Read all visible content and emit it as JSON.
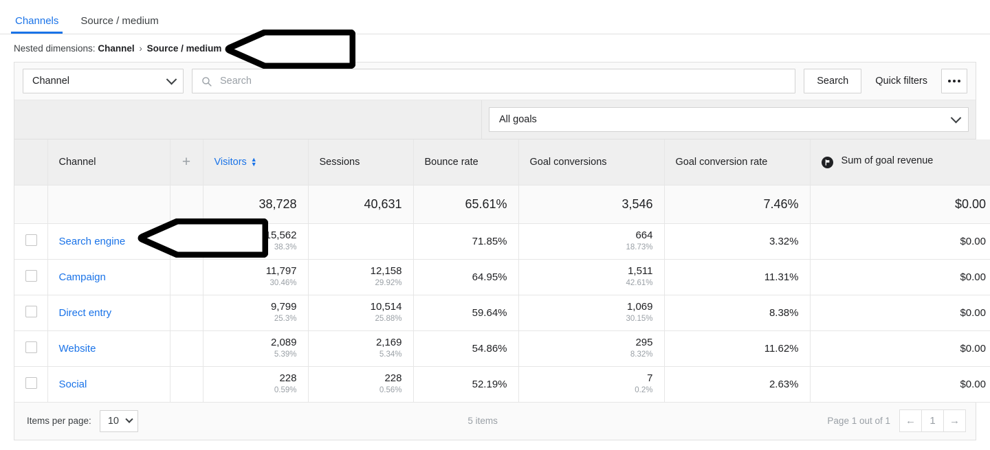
{
  "tabs": [
    {
      "label": "Channels",
      "active": true
    },
    {
      "label": "Source / medium",
      "active": false
    }
  ],
  "breadcrumb": {
    "label": "Nested dimensions:",
    "level1": "Channel",
    "separator": "›",
    "level2": "Source / medium"
  },
  "toolbar": {
    "dimension_value": "Channel",
    "search_placeholder": "Search",
    "search_value": "",
    "search_button": "Search",
    "quick_filters": "Quick filters",
    "more_menu": "•••"
  },
  "goals": {
    "selected": "All goals"
  },
  "table": {
    "columns": [
      {
        "label": "Channel",
        "key": "channel",
        "sorted": false
      },
      {
        "label": "Visitors",
        "key": "visitors",
        "sorted": true
      },
      {
        "label": "Sessions",
        "key": "sessions",
        "sorted": false
      },
      {
        "label": "Bounce rate",
        "key": "bounce_rate",
        "sorted": false
      },
      {
        "label": "Goal conversions",
        "key": "goal_conversions",
        "sorted": false
      },
      {
        "label": "Goal conversion rate",
        "key": "goal_conversion_rate",
        "sorted": false
      },
      {
        "label": "Sum of goal revenue",
        "key": "goal_revenue",
        "sorted": false,
        "badge": "flag-icon"
      }
    ],
    "totals": {
      "visitors": "38,728",
      "sessions": "40,631",
      "bounce_rate": "65.61%",
      "goal_conversions": "3,546",
      "goal_conversion_rate": "7.46%",
      "goal_revenue": "$0.00"
    },
    "rows": [
      {
        "channel": "Search engine",
        "visitors": "15,562",
        "visitors_pct": "38.3%",
        "sessions": "",
        "sessions_pct": "",
        "bounce_rate": "71.85%",
        "goal_conversions": "664",
        "goal_conversions_pct": "18.73%",
        "goal_conversion_rate": "3.32%",
        "goal_revenue": "$0.00"
      },
      {
        "channel": "Campaign",
        "visitors": "11,797",
        "visitors_pct": "30.46%",
        "sessions": "12,158",
        "sessions_pct": "29.92%",
        "bounce_rate": "64.95%",
        "goal_conversions": "1,511",
        "goal_conversions_pct": "42.61%",
        "goal_conversion_rate": "11.31%",
        "goal_revenue": "$0.00"
      },
      {
        "channel": "Direct entry",
        "visitors": "9,799",
        "visitors_pct": "25.3%",
        "sessions": "10,514",
        "sessions_pct": "25.88%",
        "bounce_rate": "59.64%",
        "goal_conversions": "1,069",
        "goal_conversions_pct": "30.15%",
        "goal_conversion_rate": "8.38%",
        "goal_revenue": "$0.00"
      },
      {
        "channel": "Website",
        "visitors": "2,089",
        "visitors_pct": "5.39%",
        "sessions": "2,169",
        "sessions_pct": "5.34%",
        "bounce_rate": "54.86%",
        "goal_conversions": "295",
        "goal_conversions_pct": "8.32%",
        "goal_conversion_rate": "11.62%",
        "goal_revenue": "$0.00"
      },
      {
        "channel": "Social",
        "visitors": "228",
        "visitors_pct": "0.59%",
        "sessions": "228",
        "sessions_pct": "0.56%",
        "bounce_rate": "52.19%",
        "goal_conversions": "7",
        "goal_conversions_pct": "0.2%",
        "goal_conversion_rate": "2.63%",
        "goal_revenue": "$0.00"
      }
    ]
  },
  "footer": {
    "items_per_page_label": "Items per page:",
    "items_per_page_value": "10",
    "items_count": "5 items",
    "page_label": "Page 1 out of 1",
    "prev": "←",
    "page_number": "1",
    "next": "→"
  },
  "annotations": [
    {
      "name": "arrow-to-nested-dimensions",
      "direction": "left"
    },
    {
      "name": "arrow-to-search-engine-row",
      "direction": "left"
    }
  ],
  "colors": {
    "accent": "#1a73e8",
    "text": "#202124",
    "muted": "#9aa0a6",
    "header_bg": "#efefef",
    "panel_border": "#e0e0e0"
  }
}
